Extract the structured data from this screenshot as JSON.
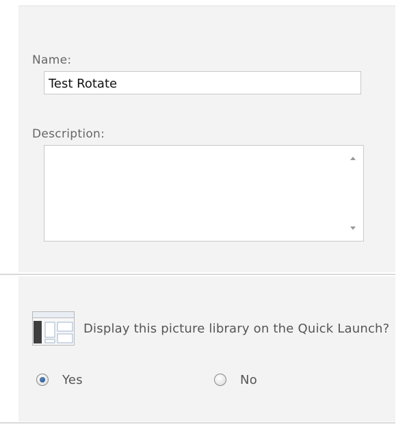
{
  "form": {
    "name_label": "Name:",
    "name_value": "Test Rotate",
    "description_label": "Description:",
    "description_value": ""
  },
  "navigation": {
    "icon": "quick-launch-icon",
    "question": "Display this picture library on the Quick Launch?",
    "options": [
      {
        "label": "Yes",
        "checked": true
      },
      {
        "label": "No",
        "checked": false
      }
    ]
  },
  "colors": {
    "panel_background": "#f3f3f3",
    "label_text": "#666666",
    "radio_selected": "#24497e"
  }
}
